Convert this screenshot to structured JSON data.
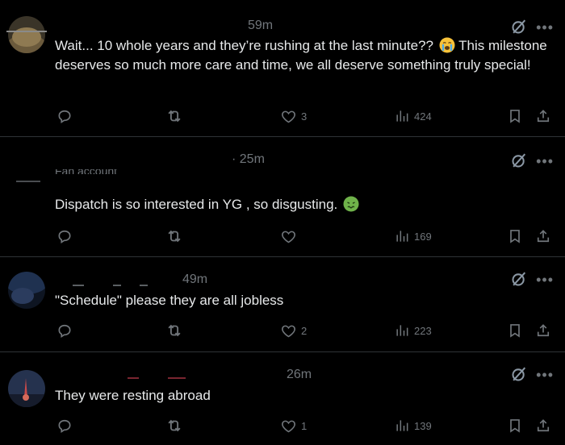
{
  "colors": {
    "background": "#000000",
    "text": "#e7e9ea",
    "muted": "#71767b",
    "divider": "#2f3336"
  },
  "posts": [
    {
      "time": "59m",
      "text": "Wait... 10 whole years and they’re rushing at the last minute??",
      "text_after_emoji": " This milestone deserves so much more care and time, we all deserve something truly special!",
      "emoji": "crying-face-emoji",
      "replies": "",
      "reposts": "",
      "likes": "3",
      "views": "424"
    },
    {
      "time": "· 25m",
      "handle_fragment": "Fan account",
      "text": "Dispatch is so interested in YG , so disgusting.",
      "emoji": "nauseated-face-emoji",
      "replies": "",
      "reposts": "",
      "likes": "",
      "views": "169"
    },
    {
      "time": "49m",
      "text": "\"Schedule\" please they are all jobless",
      "replies": "",
      "reposts": "",
      "likes": "2",
      "views": "223"
    },
    {
      "time": "26m",
      "text": "They were resting abroad",
      "replies": "",
      "reposts": "",
      "likes": "1",
      "views": "139"
    }
  ],
  "icons": {
    "reply": "reply-icon",
    "repost": "repost-icon",
    "like": "heart-icon",
    "views": "views-icon",
    "bookmark": "bookmark-icon",
    "share": "share-icon",
    "grok": "grok-icon",
    "more": "more-icon"
  }
}
